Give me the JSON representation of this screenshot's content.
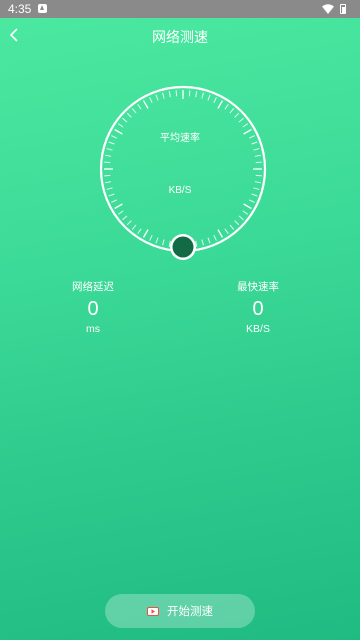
{
  "status_bar": {
    "time": "4:35",
    "notification_icon": "notification-a-icon",
    "wifi_icon": "wifi-icon",
    "battery_icon": "battery-icon"
  },
  "header": {
    "back_icon": "chevron-left-icon",
    "title": "网络测速"
  },
  "gauge": {
    "top_label": "平均速率",
    "unit_label": "KB/S",
    "level": 0,
    "knob_color": "#136b45"
  },
  "stats": {
    "latency": {
      "label": "网络延迟",
      "value": "0",
      "unit": "ms"
    },
    "max_speed": {
      "label": "最快速率",
      "value": "0",
      "unit": "KB/S"
    }
  },
  "action": {
    "start_label": "开始测速",
    "start_icon": "video-play-icon",
    "icon_color": "#e8534a"
  },
  "colors": {
    "background_top": "#4be8a0",
    "background_bottom": "#20bb82",
    "status_bar": "#8a8a8a"
  }
}
